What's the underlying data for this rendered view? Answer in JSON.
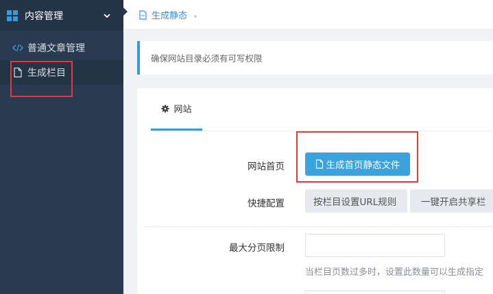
{
  "sidebar": {
    "header_title": "内容管理",
    "items": [
      {
        "label": "普通文章管理",
        "icon": "code-icon"
      },
      {
        "label": "生成栏目",
        "icon": "file-icon"
      }
    ]
  },
  "topbar": {
    "tab_label": "生成静态",
    "tab_icon": "file-icon"
  },
  "notice": {
    "text": "确保网站目录必须有可写权限"
  },
  "panel": {
    "tab_label": "网站",
    "tab_icon": "gear-icon",
    "rows": {
      "homepage_label": "网站首页",
      "homepage_button": "生成首页静态文件",
      "quick_config_label": "快捷配置",
      "quick_btn_1": "按栏目设置URL规则",
      "quick_btn_2": "一键开启共享栏",
      "max_page_label": "最大分页限制",
      "max_page_value": "",
      "max_page_help": "当栏目页数过多时，设置此数量可以生成指定"
    }
  },
  "colors": {
    "sidebar_bg": "#2a3a50",
    "accent": "#3aa3dd",
    "link": "#3a8ee6",
    "highlight_box": "#e03a3a"
  }
}
